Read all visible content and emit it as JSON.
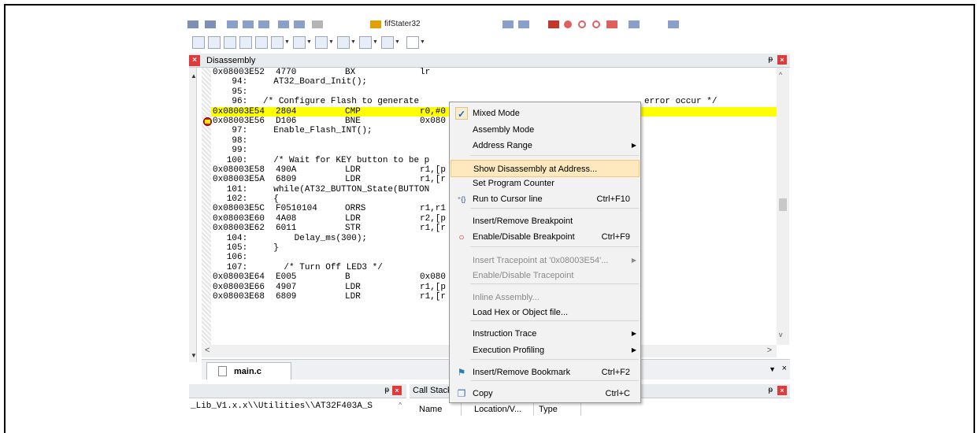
{
  "toolbar": {
    "target_name": "fifStater32"
  },
  "disassembly": {
    "title": "Disassembly",
    "lines": [
      {
        "addr": "0x08003E52",
        "op": "4770",
        "mn": "BX",
        "arg": "lr"
      },
      {
        "src": "    94:     AT32_Board_Init();"
      },
      {
        "src": "    95:"
      },
      {
        "src": "    96:   /* Configure Flash to generate",
        "tail": "error occur */"
      },
      {
        "addr": "0x08003E54",
        "op": "2804",
        "mn": "CMP",
        "arg": "r0,#0",
        "current": true
      },
      {
        "addr": "0x08003E56",
        "op": "D106",
        "mn": "BNE",
        "arg": "0x080"
      },
      {
        "src": "    97:     Enable_Flash_INT();"
      },
      {
        "src": "    98:"
      },
      {
        "src": "    99:"
      },
      {
        "src": "   100:     /* Wait for KEY button to be p"
      },
      {
        "addr": "0x08003E58",
        "op": "490A",
        "mn": "LDR",
        "arg": "r1,[p"
      },
      {
        "addr": "0x08003E5A",
        "op": "6809",
        "mn": "LDR",
        "arg": "r1,[r"
      },
      {
        "src": "   101:     while(AT32_BUTTON_State(BUTTON"
      },
      {
        "src": "   102:     {"
      },
      {
        "addr": "0x08003E5C",
        "op": "F0510104",
        "mn": "ORRS",
        "arg": "r1,r1"
      },
      {
        "addr": "0x08003E60",
        "op": "4A08",
        "mn": "LDR",
        "arg": "r2,[p"
      },
      {
        "addr": "0x08003E62",
        "op": "6011",
        "mn": "STR",
        "arg": "r1,[r"
      },
      {
        "src": "   104:         Delay_ms(300);"
      },
      {
        "src": "   105:     }"
      },
      {
        "src": "   106:"
      },
      {
        "src": "   107:       /* Turn Off LED3 */"
      },
      {
        "addr": "0x08003E64",
        "op": "E005",
        "mn": "B",
        "arg": "0x080"
      },
      {
        "addr": "0x08003E66",
        "op": "4907",
        "mn": "LDR",
        "arg": "r1,[p"
      },
      {
        "addr": "0x08003E68",
        "op": "6809",
        "mn": "LDR",
        "arg": "r1,[r"
      }
    ]
  },
  "tabs": {
    "active": "main.c"
  },
  "bottom_left": {
    "path": "_Lib_V1.x.x\\\\Utilities\\\\AT32F403A_S"
  },
  "call_stack": {
    "title": "Call Stack",
    "columns": [
      "Name",
      "Location/V...",
      "Type"
    ]
  },
  "context_menu": {
    "items": [
      {
        "label": "Mixed Mode",
        "checked": true
      },
      {
        "label": "Assembly Mode"
      },
      {
        "label": "Address Range",
        "submenu": true
      },
      {
        "label": "Show Disassembly at Address...",
        "highlighted": true
      },
      {
        "label": "Set Program Counter"
      },
      {
        "label": "Run to Cursor line",
        "shortcut": "Ctrl+F10",
        "icon": "run-to-cursor-icon"
      },
      {
        "label": "Insert/Remove Breakpoint"
      },
      {
        "label": "Enable/Disable Breakpoint",
        "shortcut": "Ctrl+F9",
        "icon": "breakpoint-circle-icon"
      },
      {
        "label": "Insert Tracepoint at '0x08003E54'...",
        "disabled": true,
        "submenu": true
      },
      {
        "label": "Enable/Disable Tracepoint",
        "disabled": true
      },
      {
        "label": "Inline Assembly...",
        "disabled": true
      },
      {
        "label": "Load Hex or Object file..."
      },
      {
        "label": "Instruction Trace",
        "submenu": true
      },
      {
        "label": "Execution Profiling",
        "submenu": true
      },
      {
        "label": "Insert/Remove Bookmark",
        "shortcut": "Ctrl+F2",
        "icon": "bookmark-flag-icon"
      },
      {
        "label": "Copy",
        "shortcut": "Ctrl+C",
        "icon": "copy-icon"
      }
    ]
  },
  "colors": {
    "current_line": "#ffff00",
    "menu_highlight": "#fde9bd",
    "close_button": "#e03a3a"
  }
}
